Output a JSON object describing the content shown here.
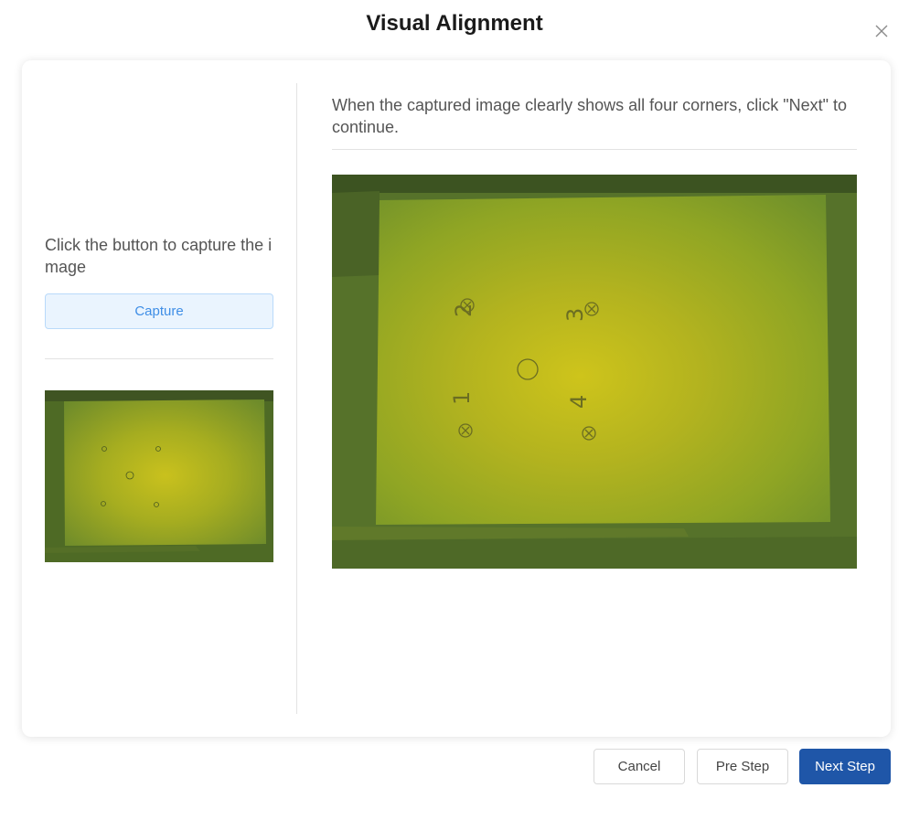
{
  "dialog": {
    "title": "Visual Alignment"
  },
  "left_panel": {
    "instruction": "Click the button to capture the image",
    "capture_label": "Capture"
  },
  "right_panel": {
    "instruction": "When the captured image clearly shows all four corners, click \"Next\" to continue.",
    "markers": [
      "1",
      "2",
      "3",
      "4"
    ]
  },
  "footer": {
    "cancel_label": "Cancel",
    "pre_step_label": "Pre Step",
    "next_step_label": "Next Step"
  },
  "icons": {
    "close": "close-icon"
  },
  "colors": {
    "primary": "#1f56a8",
    "capture_bg": "#eaf4fe",
    "capture_text": "#3f8ee6",
    "camera_green": "#6f8e2c",
    "camera_yellow": "#c9c21c"
  }
}
